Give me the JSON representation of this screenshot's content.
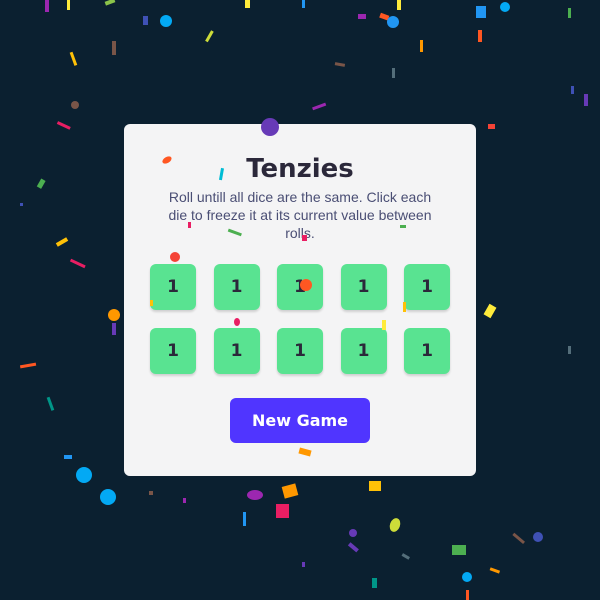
{
  "app": {
    "title": "Tenzies",
    "instructions": "Roll untill all dice are the same. Click each die to freeze it at its current value between rolls."
  },
  "dice": [
    {
      "value": "1",
      "held": true
    },
    {
      "value": "1",
      "held": true
    },
    {
      "value": "1",
      "held": true
    },
    {
      "value": "1",
      "held": true
    },
    {
      "value": "1",
      "held": true
    },
    {
      "value": "1",
      "held": true
    },
    {
      "value": "1",
      "held": true
    },
    {
      "value": "1",
      "held": true
    },
    {
      "value": "1",
      "held": true
    },
    {
      "value": "1",
      "held": true
    }
  ],
  "controls": {
    "new_game_label": "New Game"
  },
  "colors": {
    "background": "#0b2030",
    "card": "#f4f4f5",
    "die_held": "#59e391",
    "button": "#5035ff",
    "text_dark": "#2b283a",
    "text_muted": "#4a4e74"
  }
}
